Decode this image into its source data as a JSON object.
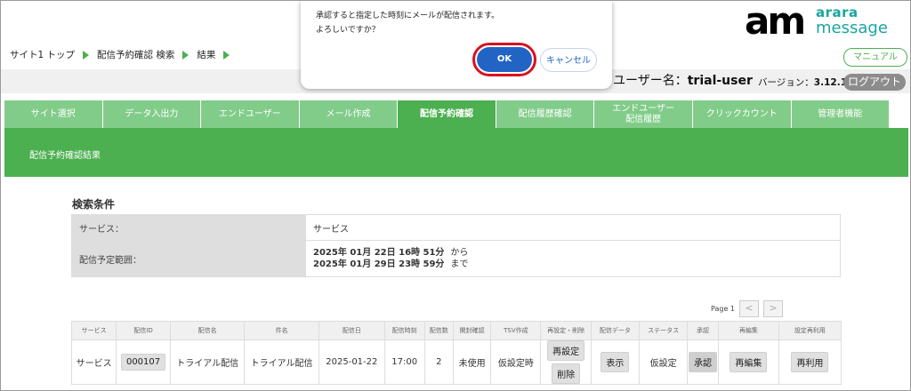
{
  "breadcrumb": [
    "サイト1 トップ",
    "配信予約確認 検索",
    "結果"
  ],
  "logo": {
    "mark_a": "a",
    "mark_m": "m",
    "line1": "arara",
    "line2": "message"
  },
  "manual_label": "マニュアル",
  "user": {
    "prefix": "ユーザー名：",
    "name": "trial-user"
  },
  "version": {
    "prefix": "バージョン：",
    "value": "3.12.1"
  },
  "logout_label": "ログアウト",
  "nav_tabs": [
    "サイト選択",
    "データ入出力",
    "エンドユーザー",
    "メール作成",
    "配信予約確認",
    "配信履歴確認",
    "エンドユーザー\n配信履歴",
    "クリックカウント",
    "管理者機能"
  ],
  "active_tab": "配信予約確認",
  "banner_title": "配信予約確認結果",
  "search": {
    "title": "検索条件",
    "service_label": "サービス：",
    "service_value": "サービス",
    "range_label": "配信予定範囲：",
    "range_from": "2025年 01月 22日 16時 51分",
    "range_from_suffix": "から",
    "range_to": "2025年 01月 29日 23時 59分",
    "range_to_suffix": "まで"
  },
  "pager": {
    "label": "Page 1",
    "prev": "<",
    "next": ">"
  },
  "table": {
    "headers": [
      "サービス",
      "配信ID",
      "配信名",
      "件名",
      "配信日",
      "配信時刻",
      "配信数",
      "開封確認",
      "TSV作成",
      "再設定・削除",
      "配信データ",
      "ステータス",
      "承認",
      "再編集",
      "設定再利用"
    ],
    "row": {
      "service": "サービス",
      "id": "000107",
      "name": "トライアル配信",
      "subject": "トライアル配信",
      "date": "2025-01-22",
      "time": "17:00",
      "count": "2",
      "open_check": "未使用",
      "tsv": "仮設定時",
      "reset_label": "再設定",
      "delete_label": "削除",
      "data_label": "表示",
      "status": "仮設定",
      "approve_label": "承認",
      "reedit_label": "再編集",
      "reuse_label": "再利用"
    }
  },
  "dialog": {
    "line1": "承認すると指定した時刻にメールが配信されます。",
    "line2": "よろしいですか？",
    "ok_label": "OK",
    "cancel_label": "キャンセル"
  }
}
